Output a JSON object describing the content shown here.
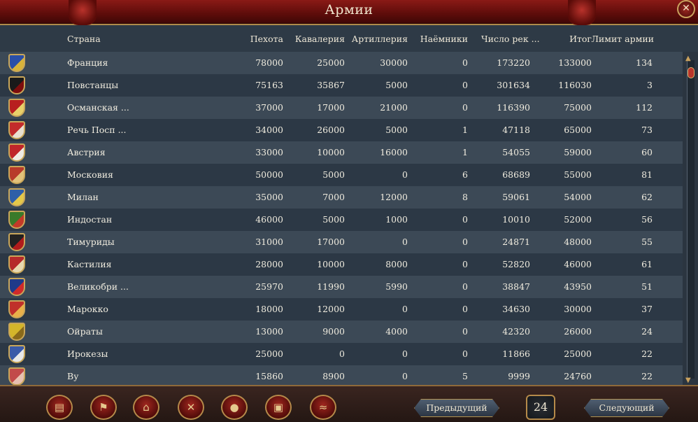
{
  "window": {
    "title": "Армии"
  },
  "columns": {
    "country": "Страна",
    "infantry": "Пехота",
    "cavalry": "Кавалерия",
    "artillery": "Артиллерия",
    "mercenaries": "Наёмники",
    "regiments": "Число рек ...",
    "total": "Итог",
    "limit": "Лимит армии"
  },
  "rows": [
    {
      "country": "Франция",
      "infantry": "78000",
      "cavalry": "25000",
      "artillery": "30000",
      "mercenaries": "0",
      "regiments": "173220",
      "total": "133000",
      "limit": "134",
      "flag_colors": [
        "#2a4fa8",
        "#d8b33a"
      ]
    },
    {
      "country": "Повстанцы",
      "infantry": "75163",
      "cavalry": "35867",
      "artillery": "5000",
      "mercenaries": "0",
      "regiments": "301634",
      "total": "116030",
      "limit": "3",
      "flag_colors": [
        "#1a1a1a",
        "#7d0d0d"
      ]
    },
    {
      "country": "Османская ...",
      "infantry": "37000",
      "cavalry": "17000",
      "artillery": "21000",
      "mercenaries": "0",
      "regiments": "116390",
      "total": "75000",
      "limit": "112",
      "flag_colors": [
        "#b81f1f",
        "#e8d06a"
      ]
    },
    {
      "country": "Речь Посп ...",
      "infantry": "34000",
      "cavalry": "26000",
      "artillery": "5000",
      "mercenaries": "1",
      "regiments": "47118",
      "total": "65000",
      "limit": "73",
      "flag_colors": [
        "#c22b2b",
        "#e8e0d0"
      ]
    },
    {
      "country": "Австрия",
      "infantry": "33000",
      "cavalry": "10000",
      "artillery": "16000",
      "mercenaries": "1",
      "regiments": "54055",
      "total": "59000",
      "limit": "60",
      "flag_colors": [
        "#c0262a",
        "#f0ece4"
      ]
    },
    {
      "country": "Московия",
      "infantry": "50000",
      "cavalry": "5000",
      "artillery": "0",
      "mercenaries": "6",
      "regiments": "68689",
      "total": "55000",
      "limit": "81",
      "flag_colors": [
        "#b83a2a",
        "#e2c27a"
      ]
    },
    {
      "country": "Милан",
      "infantry": "35000",
      "cavalry": "7000",
      "artillery": "12000",
      "mercenaries": "8",
      "regiments": "59061",
      "total": "54000",
      "limit": "62",
      "flag_colors": [
        "#2f5fa8",
        "#e4c84a"
      ]
    },
    {
      "country": "Индостан",
      "infantry": "46000",
      "cavalry": "5000",
      "artillery": "1000",
      "mercenaries": "0",
      "regiments": "10010",
      "total": "52000",
      "limit": "56",
      "flag_colors": [
        "#3a7a2a",
        "#c23a28"
      ]
    },
    {
      "country": "Тимуриды",
      "infantry": "31000",
      "cavalry": "17000",
      "artillery": "0",
      "mercenaries": "0",
      "regiments": "24871",
      "total": "48000",
      "limit": "55",
      "flag_colors": [
        "#222222",
        "#b01c1c"
      ]
    },
    {
      "country": "Кастилия",
      "infantry": "28000",
      "cavalry": "10000",
      "artillery": "8000",
      "mercenaries": "0",
      "regiments": "52820",
      "total": "46000",
      "limit": "61",
      "flag_colors": [
        "#b52a2a",
        "#e8d9b0"
      ]
    },
    {
      "country": "Великобри ...",
      "infantry": "25970",
      "cavalry": "11990",
      "artillery": "5990",
      "mercenaries": "0",
      "regiments": "38847",
      "total": "43950",
      "limit": "51",
      "flag_colors": [
        "#1f3a8a",
        "#d02a2a"
      ]
    },
    {
      "country": "Марокко",
      "infantry": "18000",
      "cavalry": "12000",
      "artillery": "0",
      "mercenaries": "0",
      "regiments": "34630",
      "total": "30000",
      "limit": "37",
      "flag_colors": [
        "#c0302a",
        "#e8b04a"
      ]
    },
    {
      "country": "Ойраты",
      "infantry": "13000",
      "cavalry": "9000",
      "artillery": "4000",
      "mercenaries": "0",
      "regiments": "42320",
      "total": "26000",
      "limit": "24",
      "flag_colors": [
        "#d4b52a",
        "#8a6a1a"
      ]
    },
    {
      "country": "Ирокезы",
      "infantry": "25000",
      "cavalry": "0",
      "artillery": "0",
      "mercenaries": "0",
      "regiments": "11866",
      "total": "25000",
      "limit": "22",
      "flag_colors": [
        "#3a5aa8",
        "#e8e8e8"
      ]
    },
    {
      "country": "Ву",
      "infantry": "15860",
      "cavalry": "8900",
      "artillery": "0",
      "mercenaries": "5",
      "regiments": "9999",
      "total": "24760",
      "limit": "22",
      "flag_colors": [
        "#c24a4a",
        "#e8c0b0"
      ]
    }
  ],
  "footer": {
    "prev_label": "Предыдущий",
    "next_label": "Следующий",
    "page": "24",
    "buttons": [
      "ledger-icon",
      "flag-icon",
      "buildings-icon",
      "crossed-swords-icon",
      "coins-icon",
      "chest-icon",
      "handshake-icon"
    ]
  }
}
